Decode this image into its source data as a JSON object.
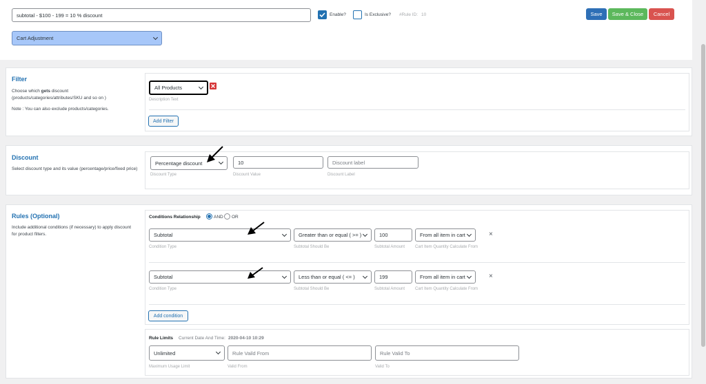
{
  "header": {
    "rule_title_value": "subtotal - $100 - 199 = 10 % discount",
    "enable_label": "Enable?",
    "exclusive_label": "Is Exclusive?",
    "rule_id_label": "#Rule ID:",
    "rule_id_value": "10",
    "save_label": "Save",
    "save_close_label": "Save & Close",
    "cancel_label": "Cancel",
    "rule_type_selected": "Cart Adjustment"
  },
  "filter": {
    "title": "Filter",
    "desc_prefix": "Choose which ",
    "desc_bold": "gets",
    "desc_suffix": " discount (products/categories/attributes/SKU and so on )",
    "note": "Note : You can also exclude products/categories.",
    "product_select": "All Products",
    "description_caption": "Description Text",
    "add_filter_label": "Add Filter"
  },
  "discount": {
    "title": "Discount",
    "desc": "Select discount type and its value (percentage/price/fixed price)",
    "type_selected": "Percentage discount",
    "type_caption": "Discount Type",
    "value": "10",
    "value_caption": "Discount Value",
    "label_placeholder": "Discount label",
    "label_caption": "Discount Label"
  },
  "rules": {
    "title": "Rules (Optional)",
    "desc": "Include additional conditions (if necessary) to apply discount for product filters.",
    "relationship_label": "Conditions Relationship",
    "and_label": "AND",
    "or_label": "OR",
    "conditions": [
      {
        "type": "Subtotal",
        "type_caption": "Condition Type",
        "operator": "Greater than or equal ( >= )",
        "operator_caption": "Subtotal Should Be",
        "amount": "100",
        "amount_caption": "Subtotal Amount",
        "calc_from": "From all item in cart",
        "calc_caption": "Cart Item Quantity Calculate From"
      },
      {
        "type": "Subtotal",
        "type_caption": "Condition Type",
        "operator": "Less than or equal ( <= )",
        "operator_caption": "Subtotal Should Be",
        "amount": "199",
        "amount_caption": "Subtotal Amount",
        "calc_from": "From all item in cart",
        "calc_caption": "Cart Item Quantity Calculate From"
      }
    ],
    "remove_symbol": "×",
    "add_condition_label": "Add condition"
  },
  "limits": {
    "title": "Rule Limits",
    "current_label": "Current Date And Time:",
    "current_value": "2020-04-10 10:29",
    "usage_selected": "Unlimited",
    "usage_caption": "Maximum Usage Limit",
    "valid_from_placeholder": "Rule Vaild From",
    "valid_from_caption": "Valid From",
    "valid_to_placeholder": "Rule Valid To",
    "valid_to_caption": "Valid To"
  },
  "colors": {
    "accent": "#2271b1",
    "save": "#2e6fb6",
    "save_close": "#5cb85c",
    "cancel": "#d9534f",
    "rule_type_bg": "#a7c7f9",
    "remove_red": "#d63638"
  }
}
